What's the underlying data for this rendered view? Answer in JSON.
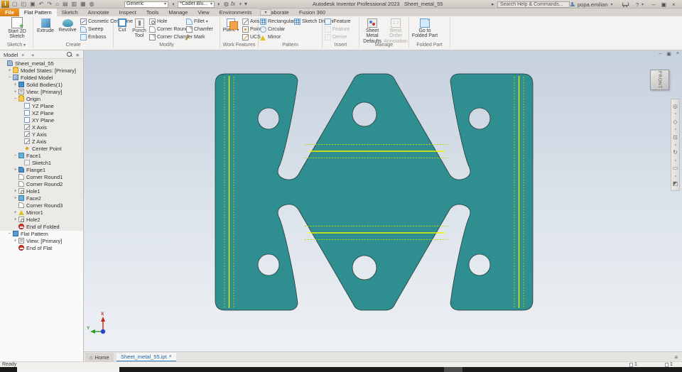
{
  "titlebar": {
    "app_logo": "I",
    "qat_icons": [
      "new-file-icon",
      "open-icon",
      "save-icon",
      "undo-icon",
      "redo-icon",
      "home-icon",
      "iproperties-icon",
      "print-icon",
      "measure-icon",
      "material-icon"
    ],
    "material_value": "Generic",
    "appearance_value": "*Cadet Blu...",
    "extra_icons": [
      "appearance-wheel-icon",
      "adjust-icon",
      "color-adjust-icon"
    ],
    "fx_label": "fx",
    "plus_label": "+",
    "app_title": "Autodesk Inventor Professional 2023",
    "doc_title": "Sheet_metal_55",
    "search_placeholder": "Search Help & Commands...",
    "user_name": "popa.emilian",
    "help_label": "?"
  },
  "tabrow": {
    "tabs": [
      "File",
      "Flat Pattern",
      "Sketch",
      "Annotate",
      "Inspect",
      "Tools",
      "Manage",
      "View",
      "Environments",
      "Collaborate",
      "Fusion 360"
    ],
    "active_tab": "Flat Pattern"
  },
  "ribbon": {
    "sketch": {
      "panel_label": "Sketch",
      "start_2d": "Start 2D Sketch"
    },
    "create": {
      "panel_label": "Create",
      "extrude": "Extrude",
      "revolve": "Revolve",
      "cosmetic": "Cosmetic Centerline",
      "sweep": "Sweep",
      "emboss": "Emboss"
    },
    "modify": {
      "panel_label": "Modify",
      "cut": "Cut",
      "punch": "Punch Tool",
      "hole": "Hole",
      "corner_round": "Corner Round",
      "corner_chamfer": "Corner Chamfer",
      "fillet": "Fillet",
      "chamfer": "Chamfer",
      "mark": "Mark"
    },
    "work": {
      "panel_label": "Work Features",
      "plane": "Plane",
      "axis": "Axis",
      "point": "Point",
      "ucs": "UCS"
    },
    "pattern": {
      "panel_label": "Pattern",
      "rectangular": "Rectangular",
      "sketch_driven": "Sketch Driven",
      "circular": "Circular",
      "mirror": "Mirror"
    },
    "insert": {
      "panel_label": "Insert",
      "ifeature": "iFeature",
      "feature": "Feature",
      "derive": "Derive"
    },
    "manage": {
      "panel_label": "Manage",
      "sheet_metal_defaults": "Sheet Metal Defaults",
      "bend_order": "Bend Order Annotation"
    },
    "folded": {
      "panel_label": "Folded Part",
      "goto_folded": "Go to Folded Part"
    }
  },
  "browser": {
    "panel_tab": "Model",
    "close_glyph": "×",
    "add_glyph": "+",
    "rows": [
      {
        "label": "Sheet_metal_55",
        "depth": 0,
        "exp": "",
        "icon": "part-document-icon"
      },
      {
        "label": "Model States: [Primary]",
        "depth": 1,
        "exp": "+",
        "icon": "folder-icon"
      },
      {
        "label": "Folded Model",
        "depth": 1,
        "exp": "−",
        "icon": "folded-model-icon"
      },
      {
        "label": "Solid Bodies(1)",
        "depth": 2,
        "exp": "+",
        "icon": "solid-icon"
      },
      {
        "label": "View: [Primary]",
        "depth": 2,
        "exp": "+",
        "icon": "view-icon"
      },
      {
        "label": "Origin",
        "depth": 2,
        "exp": "−",
        "icon": "folder-icon"
      },
      {
        "label": "YZ Plane",
        "depth": 3,
        "exp": "",
        "icon": "plane-icon"
      },
      {
        "label": "XZ Plane",
        "depth": 3,
        "exp": "",
        "icon": "plane-icon"
      },
      {
        "label": "XY Plane",
        "depth": 3,
        "exp": "",
        "icon": "plane-icon"
      },
      {
        "label": "X Axis",
        "depth": 3,
        "exp": "",
        "icon": "axis-icon"
      },
      {
        "label": "Y Axis",
        "depth": 3,
        "exp": "",
        "icon": "axis-icon"
      },
      {
        "label": "Z Axis",
        "depth": 3,
        "exp": "",
        "icon": "axis-icon"
      },
      {
        "label": "Center Point",
        "depth": 3,
        "exp": "",
        "icon": "center-point-icon"
      },
      {
        "label": "Face1",
        "depth": 2,
        "exp": "−",
        "icon": "face-icon"
      },
      {
        "label": "Sketch1",
        "depth": 3,
        "exp": "",
        "icon": "sketch-icon"
      },
      {
        "label": "Flange1",
        "depth": 2,
        "exp": "+",
        "icon": "flange-icon"
      },
      {
        "label": "Corner Round1",
        "depth": 2,
        "exp": "",
        "icon": "corner-round-icon"
      },
      {
        "label": "Corner Round2",
        "depth": 2,
        "exp": "",
        "icon": "corner-round-icon"
      },
      {
        "label": "Hole1",
        "depth": 2,
        "exp": "+",
        "icon": "hole-icon"
      },
      {
        "label": "Face2",
        "depth": 2,
        "exp": "+",
        "icon": "face-icon"
      },
      {
        "label": "Corner Round3",
        "depth": 2,
        "exp": "",
        "icon": "corner-round-icon"
      },
      {
        "label": "Mirror1",
        "depth": 2,
        "exp": "+",
        "icon": "mirror-icon"
      },
      {
        "label": "Hole2",
        "depth": 2,
        "exp": "+",
        "icon": "hole-icon"
      },
      {
        "label": "End of Folded",
        "depth": 2,
        "exp": "",
        "icon": "end-marker-icon"
      },
      {
        "label": "Flat Pattern",
        "depth": 1,
        "exp": "−",
        "icon": "flat-pattern-icon"
      },
      {
        "label": "View: [Primary]",
        "depth": 2,
        "exp": "+",
        "icon": "view-icon"
      },
      {
        "label": "End of Flat",
        "depth": 2,
        "exp": "",
        "icon": "end-marker-icon"
      }
    ]
  },
  "canvas": {
    "viewcube_face": "FRONT",
    "navbar_icons": [
      "navigation-wheel-icon",
      "pan-icon",
      "zoom-window-icon",
      "orbit-icon",
      "look-at-icon",
      "appearance-mini-icon"
    ],
    "triad": {
      "x_label": "X",
      "y_label": "Y"
    },
    "part_color": "#2F8E90",
    "bend_centerline_color": "#EDF400",
    "bend_extent_color": "#B8D400"
  },
  "doctabs": {
    "home_label": "Home",
    "doc_label": "Sheet_metal_55.ipt",
    "close_glyph": "×"
  },
  "statusbar": {
    "status_text": "Ready",
    "count_1": "1",
    "count_2": "1"
  }
}
